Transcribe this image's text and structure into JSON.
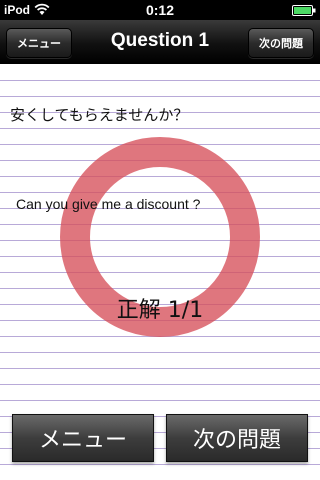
{
  "statusbar": {
    "carrier": "iPod",
    "time": "0:12"
  },
  "navbar": {
    "title": "Question 1",
    "left_button": "メニュー",
    "right_button": "次の問題"
  },
  "content": {
    "question_jp": "安くしてもらえませんか？",
    "question_en": "Can you give me a discount ?",
    "score": "正解 1/1"
  },
  "bottom": {
    "menu_label": "メニュー",
    "next_label": "次の問題"
  },
  "colors": {
    "correct_mark": "#d6505a",
    "ruled_line": "#b8a9d8"
  },
  "icons": [
    "wifi-icon",
    "battery-icon"
  ]
}
